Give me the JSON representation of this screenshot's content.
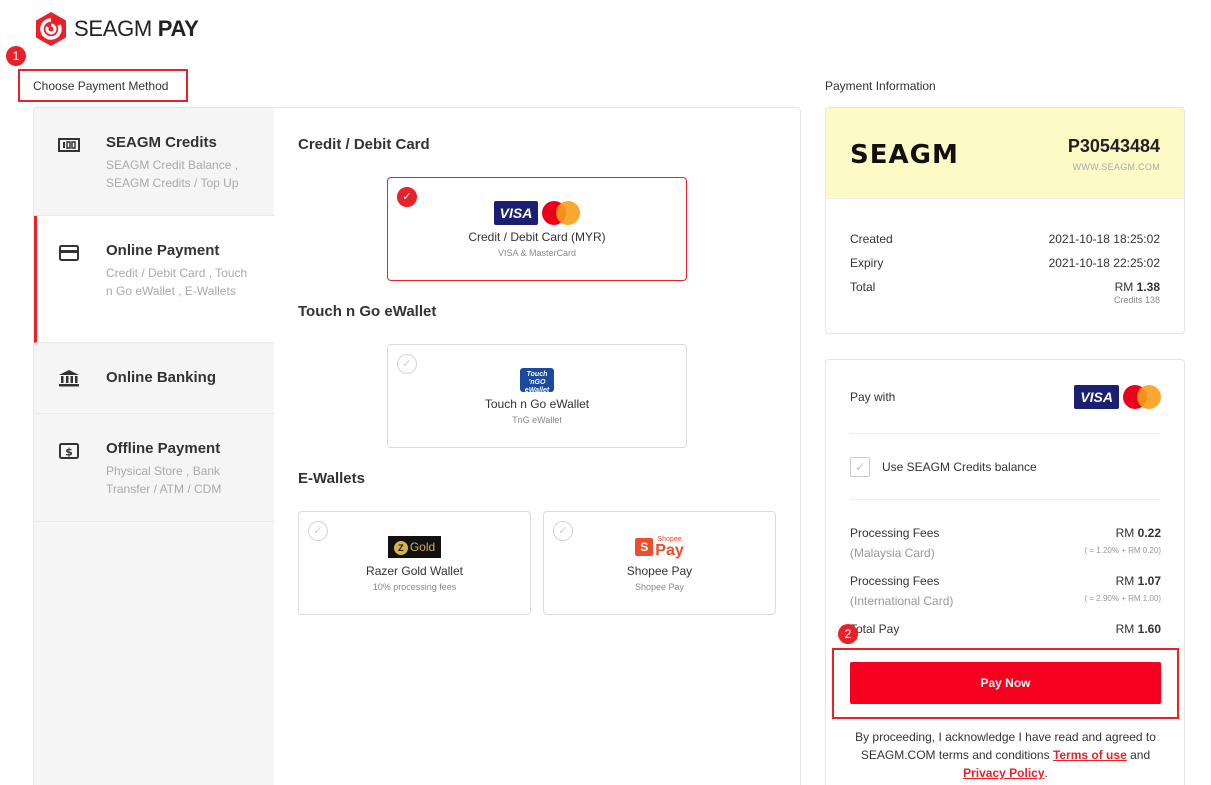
{
  "brand": {
    "name_light": "SEAGM",
    "name_bold": "PAY"
  },
  "annotations": {
    "step1": "1",
    "step2": "2"
  },
  "choose_title": "Choose Payment Method",
  "info_title": "Payment Information",
  "sidebar": {
    "items": [
      {
        "title": "SEAGM Credits",
        "desc": "SEAGM Credit Balance , SEAGM Credits / Top Up",
        "icon": "credits-icon"
      },
      {
        "title": "Online Payment",
        "desc": "Credit / Debit Card , Touch n Go eWallet , E-Wallets",
        "icon": "card-icon"
      },
      {
        "title": "Online Banking",
        "desc": "",
        "icon": "bank-icon"
      },
      {
        "title": "Offline Payment",
        "desc": "Physical Store , Bank Transfer / ATM / CDM",
        "icon": "cash-icon"
      }
    ]
  },
  "groups": {
    "card": {
      "title": "Credit / Debit Card",
      "option": {
        "name": "Credit / Debit Card (MYR)",
        "sub": "VISA & MasterCard",
        "visa": "VISA"
      }
    },
    "tng": {
      "title": "Touch n Go eWallet",
      "option": {
        "name": "Touch n Go eWallet",
        "sub": "TnG eWallet",
        "logo_l1": "Touch",
        "logo_l2": "'nGO",
        "logo_l3": "eWallet"
      }
    },
    "ewallets": {
      "title": "E-Wallets",
      "razer": {
        "name": "Razer Gold Wallet",
        "sub": "10% processing fees",
        "logo": "Gold",
        "logo_z": "Z"
      },
      "shopee": {
        "name": "Shopee Pay",
        "sub": "Shopee Pay",
        "logo_bag": "S",
        "logo": "Pay",
        "logo_small": "Shopee"
      }
    }
  },
  "info": {
    "brand_word": "SEAGM",
    "order_id": "P30543484",
    "site": "WWW.SEAGM.COM",
    "created_label": "Created",
    "created": "2021-10-18 18:25:02",
    "expiry_label": "Expiry",
    "expiry": "2021-10-18 22:25:02",
    "total_label": "Total",
    "total_prefix": "RM",
    "total": "1.38",
    "credits": "Credits 138"
  },
  "pay": {
    "pay_with": "Pay with",
    "visa": "VISA",
    "use_credits": "Use SEAGM Credits balance",
    "fee_my_label": "Processing Fees",
    "fee_my_sub": "(Malaysia Card)",
    "fee_my_prefix": "RM",
    "fee_my": "0.22",
    "fee_my_formula": "( = 1.20% + RM 0.20)",
    "fee_int_label": "Processing Fees",
    "fee_int_sub": "(International Card)",
    "fee_int_prefix": "RM",
    "fee_int": "1.07",
    "fee_int_formula": "( = 2.90% + RM 1.00)",
    "total_label": "Total Pay",
    "total_prefix": "RM",
    "total": "1.60",
    "button": "Pay Now",
    "terms_pre": "By proceeding, I acknowledge I have read and agreed to SEAGM.COM terms and conditions",
    "terms_link": "Terms of use",
    "terms_and": "and",
    "privacy_link": "Privacy Policy",
    "terms_end": "."
  },
  "colors": {
    "accent": "#e8222b",
    "button": "#f5001e",
    "info_header": "#fdfac5"
  }
}
